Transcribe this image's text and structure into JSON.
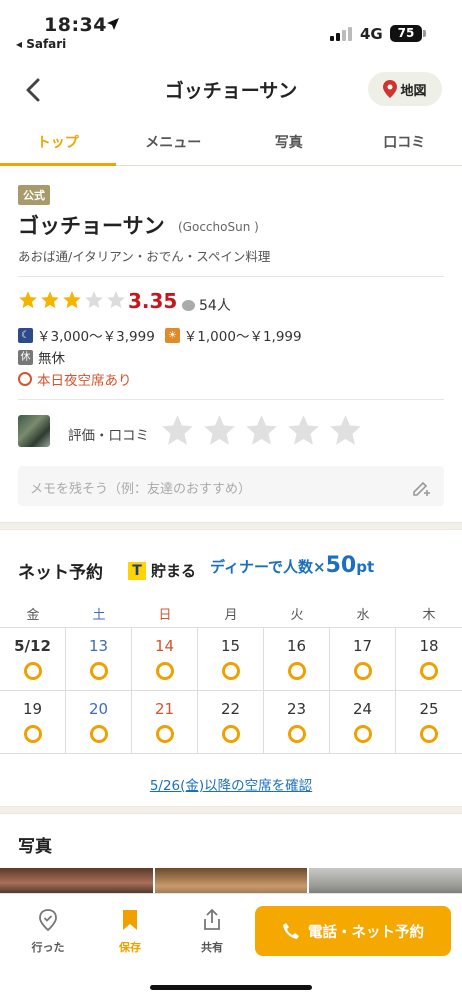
{
  "status_bar": {
    "time": "18:34",
    "back_app": "◂ Safari",
    "network": "4G",
    "battery": "75"
  },
  "header": {
    "title": "ゴッチョーサン",
    "map_label": "地図"
  },
  "tabs": [
    {
      "label": "トップ",
      "active": true
    },
    {
      "label": "メニュー",
      "active": false
    },
    {
      "label": "写真",
      "active": false
    },
    {
      "label": "口コミ",
      "active": false
    }
  ],
  "shop": {
    "official_badge": "公式",
    "name": "ゴッチョーサン",
    "name_roman": "(GocchoSun )",
    "genre": "あおば通/イタリアン・おでん・スペイン料理",
    "rating": "3.35",
    "rating_value": 3.35,
    "review_count": "54人",
    "dinner_price": "￥3,000～￥3,999",
    "lunch_price": "￥1,000～￥1,999",
    "holiday_badge": "休",
    "holiday": "無休",
    "availability": "本日夜空席あり"
  },
  "my_rating": {
    "label": "評価・口コミ",
    "memo_placeholder": "メモを残そう（例：友達のおすすめ）"
  },
  "reservation": {
    "title": "ネット予約",
    "tpoint_badge": "T",
    "tpoint_label": "貯まる",
    "dinner_prefix": "ディナーで人数×",
    "dinner_points": "50",
    "dinner_unit": "pt",
    "weekdays": [
      "金",
      "土",
      "日",
      "月",
      "火",
      "水",
      "木"
    ],
    "week1": [
      "5/12",
      "13",
      "14",
      "15",
      "16",
      "17",
      "18"
    ],
    "week2": [
      "19",
      "20",
      "21",
      "22",
      "23",
      "24",
      "25"
    ],
    "after_link": "5/26(金)以降の空席を確認"
  },
  "photos": {
    "title": "写真"
  },
  "bottom_bar": {
    "visited": "行った",
    "save": "保存",
    "share": "共有",
    "call": "電話・ネット予約"
  },
  "colors": {
    "accent": "#f5a800",
    "score_red": "#c8161d",
    "link_blue": "#1a6fc1",
    "saturday": "#3b6db7",
    "sunday": "#d4542d"
  }
}
